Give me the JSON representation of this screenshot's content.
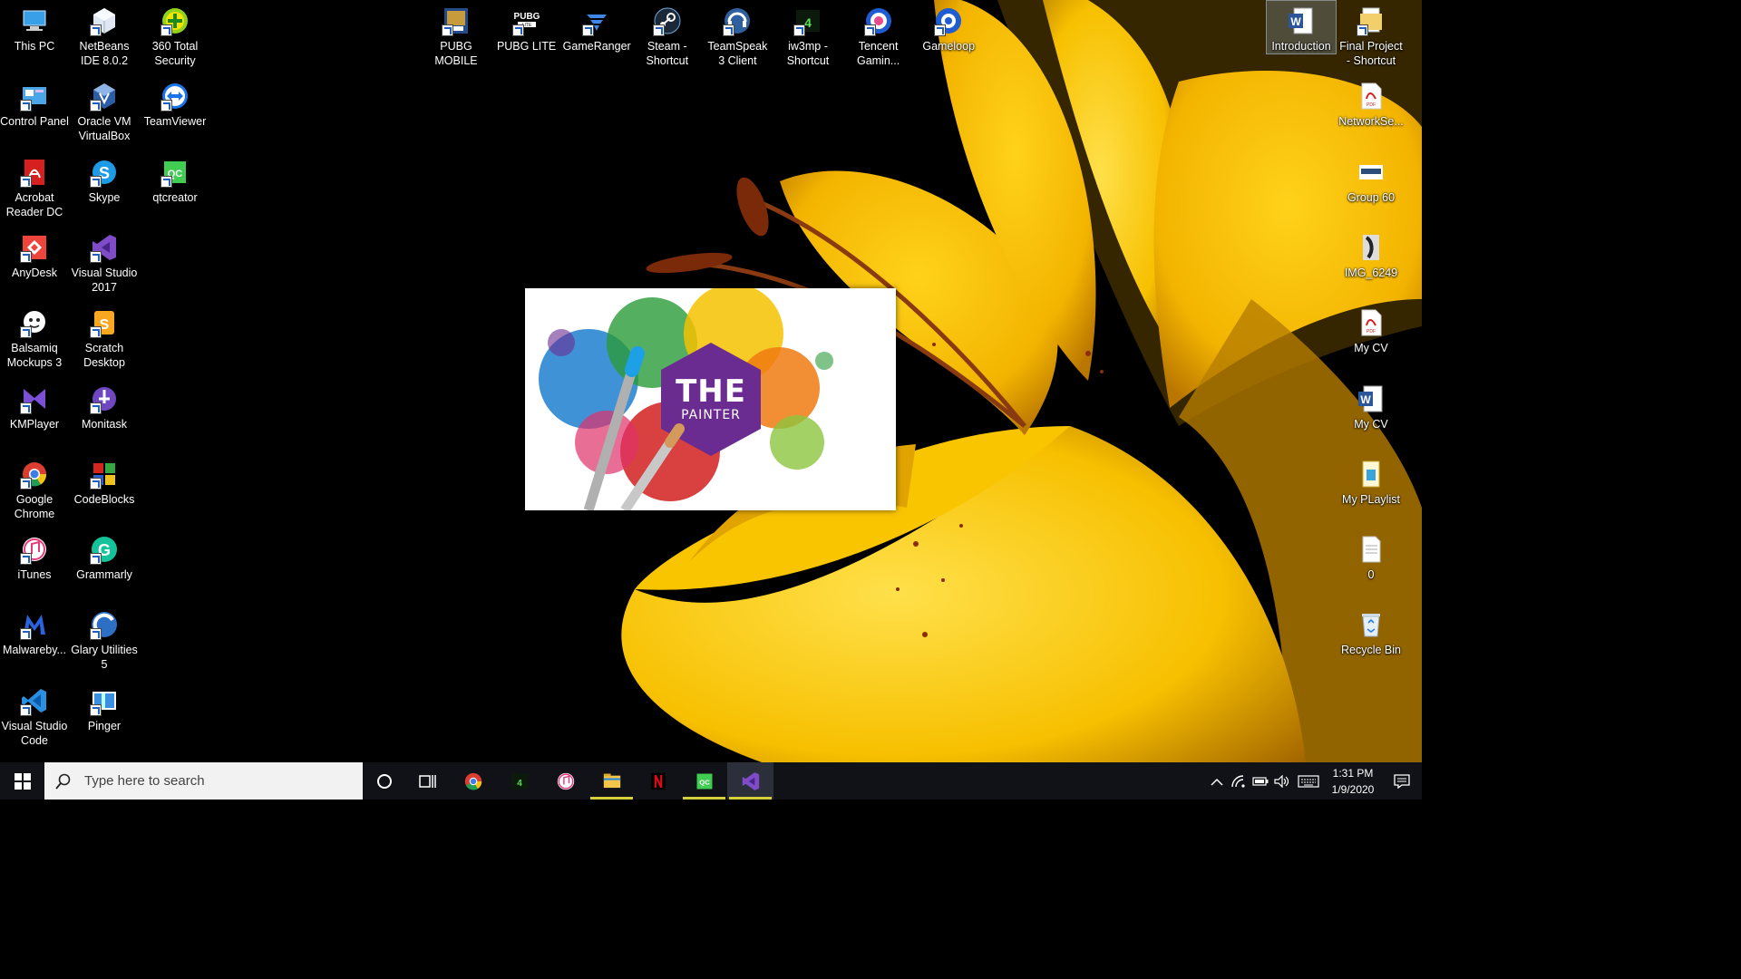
{
  "desktop": {
    "left_column_1": [
      {
        "label": "This PC",
        "icon": "this-pc-icon"
      },
      {
        "label": "Control Panel",
        "icon": "control-panel-icon"
      },
      {
        "label": "Acrobat Reader DC",
        "icon": "acrobat-icon"
      },
      {
        "label": "AnyDesk",
        "icon": "anydesk-icon"
      },
      {
        "label": "Balsamiq Mockups 3",
        "icon": "balsamiq-icon"
      },
      {
        "label": "KMPlayer",
        "icon": "kmplayer-icon"
      },
      {
        "label": "Google Chrome",
        "icon": "chrome-icon"
      },
      {
        "label": "iTunes",
        "icon": "itunes-icon"
      },
      {
        "label": "Malwareby...",
        "icon": "malwarebytes-icon"
      },
      {
        "label": "Visual Studio Code",
        "icon": "vscode-icon"
      }
    ],
    "left_column_2": [
      {
        "label": "NetBeans IDE 8.0.2",
        "icon": "netbeans-icon"
      },
      {
        "label": "Oracle VM VirtualBox",
        "icon": "virtualbox-icon"
      },
      {
        "label": "Skype",
        "icon": "skype-icon"
      },
      {
        "label": "Visual Studio 2017",
        "icon": "visual-studio-icon"
      },
      {
        "label": "Scratch Desktop",
        "icon": "scratch-icon"
      },
      {
        "label": "Monitask",
        "icon": "monitask-icon"
      },
      {
        "label": "CodeBlocks",
        "icon": "codeblocks-icon"
      },
      {
        "label": "Grammarly",
        "icon": "grammarly-icon"
      },
      {
        "label": "Glary Utilities 5",
        "icon": "glary-icon"
      },
      {
        "label": "Pinger",
        "icon": "pinger-icon"
      }
    ],
    "left_column_3": [
      {
        "label": "360 Total Security",
        "icon": "360-security-icon"
      },
      {
        "label": "TeamViewer",
        "icon": "teamviewer-icon"
      },
      {
        "label": "qtcreator",
        "icon": "qtcreator-icon"
      }
    ],
    "top_row": [
      {
        "label": "PUBG MOBILE",
        "icon": "pubg-mobile-icon"
      },
      {
        "label": "PUBG LITE",
        "icon": "pubg-lite-icon"
      },
      {
        "label": "GameRanger",
        "icon": "gameranger-icon"
      },
      {
        "label": "Steam - Shortcut",
        "icon": "steam-icon"
      },
      {
        "label": "TeamSpeak 3 Client",
        "icon": "teamspeak-icon"
      },
      {
        "label": "iw3mp - Shortcut",
        "icon": "iw3mp-icon"
      },
      {
        "label": "Tencent Gamin...",
        "icon": "tencent-icon"
      },
      {
        "label": "Gameloop",
        "icon": "gameloop-icon"
      }
    ],
    "right_column_1": [
      {
        "label": "Introduction",
        "icon": "word-doc-icon"
      }
    ],
    "right_column_2": [
      {
        "label": "Final Project - Shortcut",
        "icon": "folder-shortcut-icon"
      },
      {
        "label": "NetworkSe...",
        "icon": "pdf-icon"
      },
      {
        "label": "Group 60",
        "icon": "image-file-icon"
      },
      {
        "label": "IMG_6249",
        "icon": "photo-icon"
      },
      {
        "label": "My CV",
        "icon": "pdf-icon"
      },
      {
        "label": "My CV",
        "icon": "word-doc-icon"
      },
      {
        "label": "My PLaylist",
        "icon": "playlist-icon"
      },
      {
        "label": "0",
        "icon": "text-file-icon"
      },
      {
        "label": "Recycle Bin",
        "icon": "recycle-bin-icon"
      }
    ]
  },
  "splash": {
    "line1": "THE",
    "line2": "PAINTER"
  },
  "taskbar": {
    "search_placeholder": "Type here to search",
    "pinned": [
      {
        "name": "chrome",
        "open": false
      },
      {
        "name": "iw3mp",
        "open": false
      },
      {
        "name": "itunes",
        "open": false
      },
      {
        "name": "file-explorer",
        "open": true
      },
      {
        "name": "netflix",
        "open": false
      },
      {
        "name": "qtcreator",
        "open": true
      },
      {
        "name": "visual-studio",
        "open": true
      }
    ],
    "time": "1:31 PM",
    "date": "1/9/2020"
  },
  "colors": {
    "taskbar": "#101217",
    "open_indicator": "#d5cf39",
    "painter_hex": "#6a2c91"
  }
}
